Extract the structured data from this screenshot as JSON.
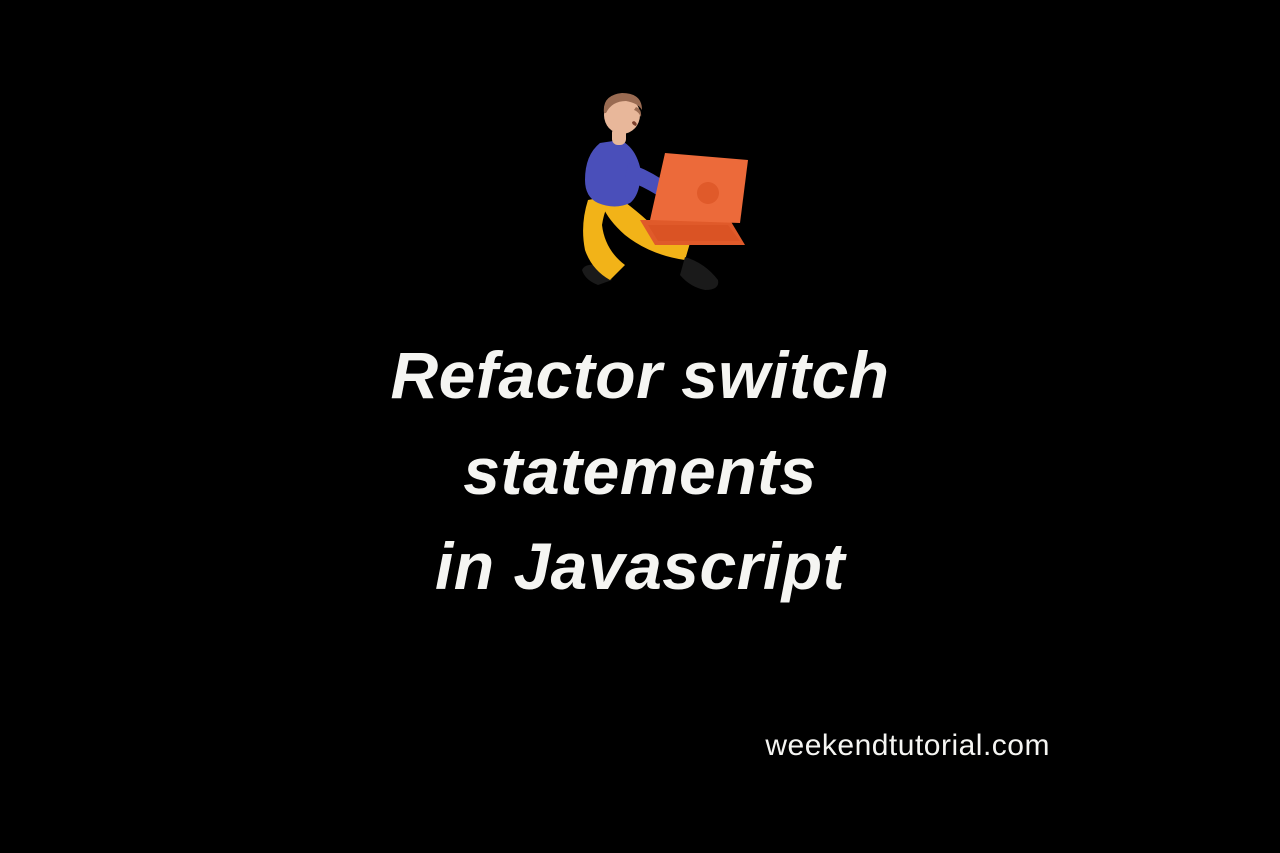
{
  "headline": {
    "line1": "Refactor switch",
    "line2": "statements",
    "line3": "in Javascript"
  },
  "attribution": "weekendtutorial.com",
  "illustration": {
    "name": "person-with-laptop",
    "colors": {
      "hair": "#9a6b52",
      "skin": "#e8b79a",
      "shirt": "#4a4fba",
      "pants": "#f2b318",
      "laptop": "#ec6a3a",
      "laptopAccent": "#e05a2a",
      "shoe": "#1a1a1a"
    }
  }
}
